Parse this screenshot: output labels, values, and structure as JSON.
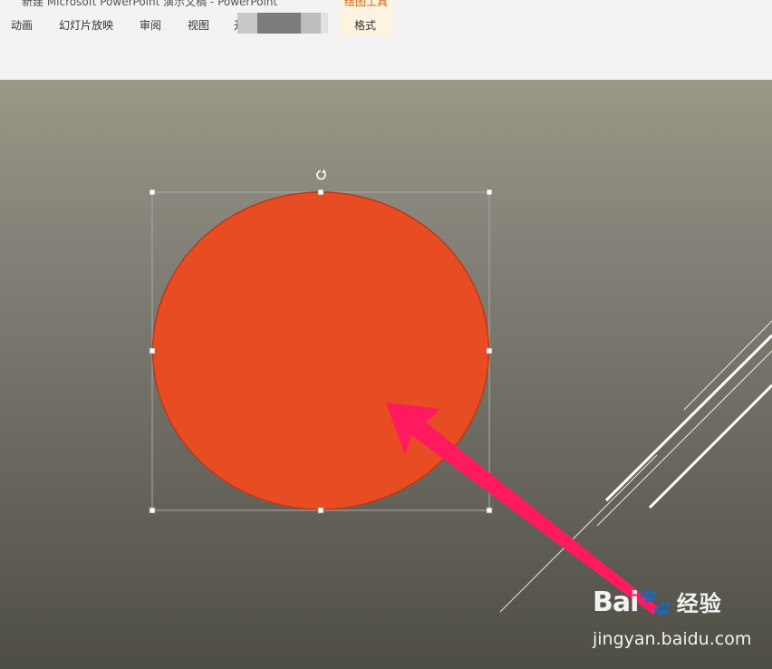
{
  "window": {
    "title": "新建 Microsoft PowerPoint 演示文稿 - PowerPoint"
  },
  "ribbon": {
    "tabs": [
      {
        "label": "动画"
      },
      {
        "label": "幻灯片放映"
      },
      {
        "label": "审阅"
      },
      {
        "label": "视图"
      }
    ],
    "partial_tab": "开",
    "contextual_group": "绘图工具",
    "contextual_tab": "格式"
  },
  "slide": {
    "shape": {
      "type": "oval",
      "fill": "#e84c22",
      "outline": "#b73a1a",
      "selected": true
    },
    "annotation_arrow_color": "#ff1a60",
    "decoration_line_color": "#ffffff"
  },
  "watermark": {
    "logo": "Bai",
    "logo_suffix": "经验",
    "url": "jingyan.baidu.com"
  }
}
